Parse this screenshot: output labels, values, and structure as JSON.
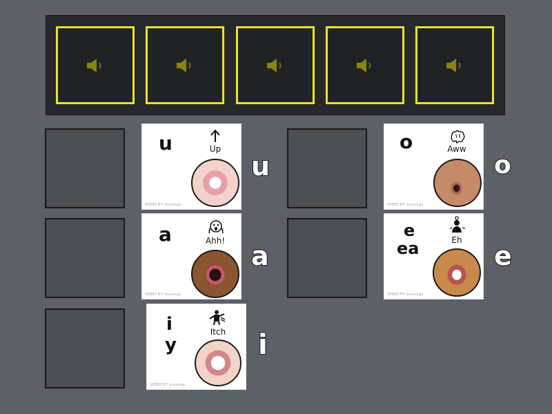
{
  "audio_slots": [
    {
      "icon": "speaker-icon"
    },
    {
      "icon": "speaker-icon"
    },
    {
      "icon": "speaker-icon"
    },
    {
      "icon": "speaker-icon"
    },
    {
      "icon": "speaker-icon"
    }
  ],
  "cards": [
    {
      "letters": [
        "u"
      ],
      "word": "Up",
      "icon": "arrow-up-icon",
      "side_label": "u",
      "brand": "SPEECHY musings"
    },
    {
      "letters": [
        "a"
      ],
      "word": "Ahh!",
      "icon": "scared-face-icon",
      "side_label": "a",
      "brand": "SPEECHY musings"
    },
    {
      "letters": [
        "i",
        "y"
      ],
      "word": "Itch",
      "icon": "itching-person-icon",
      "side_label": "i",
      "brand": "SPEECHY musings"
    },
    {
      "letters": [
        "o"
      ],
      "word": "Aww",
      "icon": "brain-icon",
      "side_label": "o",
      "brand": "SPEECHY musings"
    },
    {
      "letters": [
        "e",
        "ea"
      ],
      "word": "Eh",
      "icon": "person-thinking-icon",
      "side_label": "e",
      "brand": "SPEECHY musings"
    }
  ],
  "colors": {
    "background": "#5b6167",
    "slot_border": "#ece22a",
    "speaker": "#8a8410"
  }
}
